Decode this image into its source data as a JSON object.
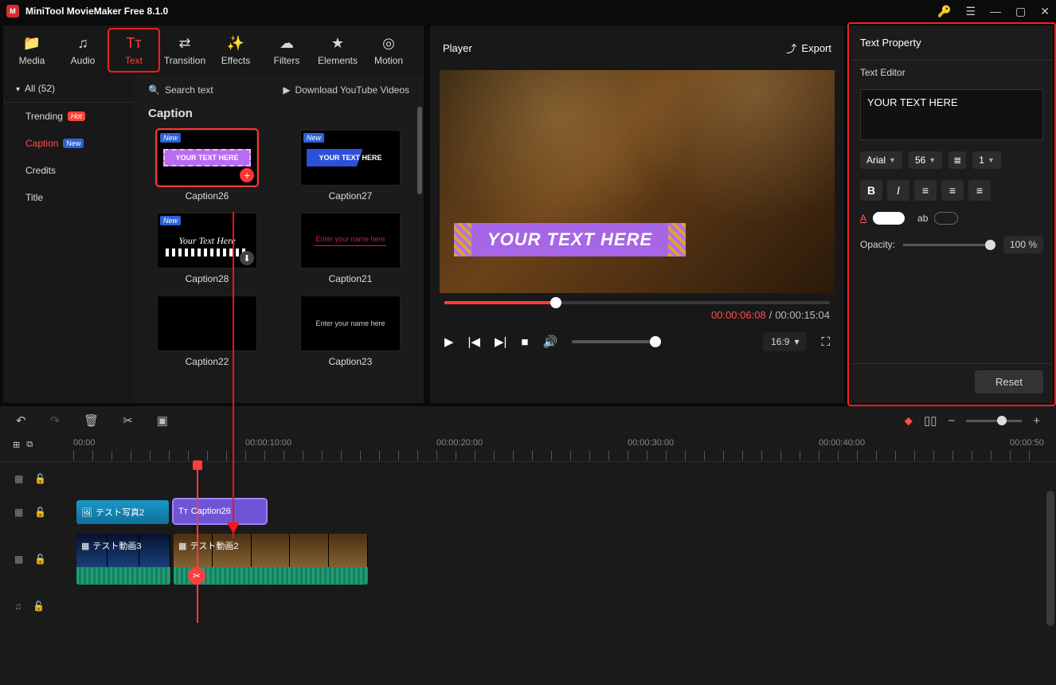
{
  "titlebar": {
    "app_title": "MiniTool MovieMaker Free 8.1.0"
  },
  "main_tabs": {
    "media": "Media",
    "audio": "Audio",
    "text": "Text",
    "transition": "Transition",
    "effects": "Effects",
    "filters": "Filters",
    "elements": "Elements",
    "motion": "Motion"
  },
  "categories": {
    "header": "All (52)",
    "trending": "Trending",
    "trending_badge": "Hot",
    "caption": "Caption",
    "caption_badge": "New",
    "credits": "Credits",
    "title": "Title"
  },
  "search": {
    "placeholder": "Search text",
    "youtube": "Download YouTube Videos"
  },
  "panel_title": "Caption",
  "captions": [
    {
      "id": "c26",
      "label": "Caption26",
      "new": true,
      "thumb_text": "YOUR TEXT HERE",
      "selected": true,
      "addable": true
    },
    {
      "id": "c27",
      "label": "Caption27",
      "new": true,
      "thumb_text": "YOUR TEXT HERE"
    },
    {
      "id": "c28",
      "label": "Caption28",
      "new": true,
      "thumb_text": "Your Text Here",
      "download": true
    },
    {
      "id": "c21",
      "label": "Caption21",
      "thumb_text": "Enter your name here"
    },
    {
      "id": "c22",
      "label": "Caption22",
      "thumb_text": ""
    },
    {
      "id": "c23",
      "label": "Caption23",
      "thumb_text": "Enter your name here"
    }
  ],
  "player": {
    "title": "Player",
    "export": "Export",
    "overlay_text": "YOUR TEXT HERE",
    "time_current": "00:00:06:08",
    "time_total": "00:00:15:04",
    "aspect": "16:9"
  },
  "prop": {
    "title": "Text Property",
    "editor_label": "Text Editor",
    "text_value": "YOUR TEXT HERE",
    "font": "Arial",
    "size": "56",
    "spacing": "1",
    "opacity_label": "Opacity:",
    "opacity_value": "100 %",
    "reset": "Reset"
  },
  "ruler": [
    "00:00",
    "00:00:10:00",
    "00:00:20:00",
    "00:00:30:00",
    "00:00:40:00",
    "00:00:50"
  ],
  "timeline": {
    "photo_clip": "テスト写真2",
    "text_clip": "Caption26",
    "video_clip_a": "テスト動画3",
    "video_clip_b": "テスト動画2"
  }
}
